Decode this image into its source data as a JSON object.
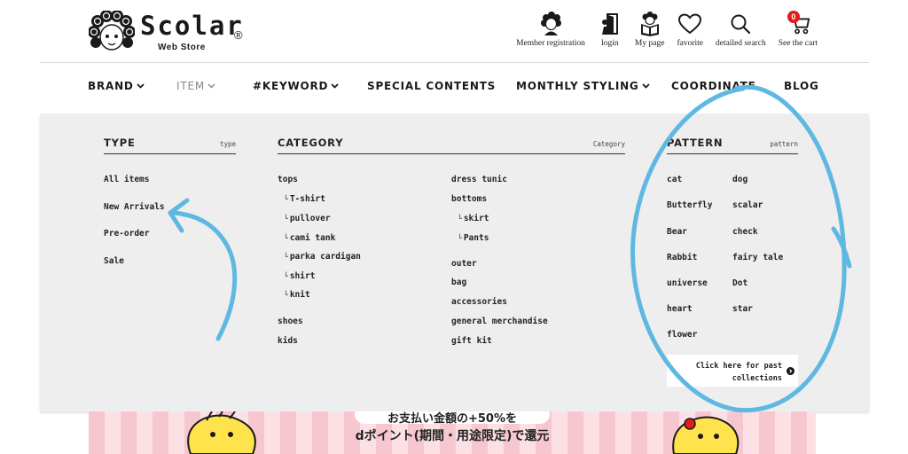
{
  "logo": {
    "wordmark": "Scolar",
    "sub": "Web Store",
    "reg": "®"
  },
  "header_nav": [
    {
      "label": "Member registration",
      "icon": "member-icon"
    },
    {
      "label": "login",
      "icon": "login-door-icon"
    },
    {
      "label": "My page",
      "icon": "mypage-icon"
    },
    {
      "label": "favorite",
      "icon": "heart-icon"
    },
    {
      "label": "detailed search",
      "icon": "search-icon"
    },
    {
      "label": "See the cart",
      "icon": "cart-icon",
      "badge": "0"
    }
  ],
  "main_nav": [
    {
      "label": "BRAND",
      "dropdown": true
    },
    {
      "label": "ITEM",
      "dropdown": true,
      "active": true
    },
    {
      "label": "#KEYWORD",
      "dropdown": true
    },
    {
      "label": "SPECIAL CONTENTS",
      "dropdown": false
    },
    {
      "label": "MONTHLY STYLING",
      "dropdown": true
    },
    {
      "label": "COORDINATE",
      "dropdown": false
    },
    {
      "label": "BLOG",
      "dropdown": false
    }
  ],
  "dropdown": {
    "type": {
      "title": "TYPE",
      "subtitle": "type",
      "items": [
        "All items",
        "New Arrivals",
        "Pre-order",
        "Sale"
      ]
    },
    "category": {
      "title": "CATEGORY",
      "subtitle": "Category",
      "col1": [
        {
          "label": "tops",
          "sub": false
        },
        {
          "label": "T-shirt",
          "sub": true
        },
        {
          "label": "pullover",
          "sub": true
        },
        {
          "label": "cami tank",
          "sub": true
        },
        {
          "label": "parka cardigan",
          "sub": true
        },
        {
          "label": "shirt",
          "sub": true
        },
        {
          "label": "knit",
          "sub": true
        },
        {
          "label": "shoes",
          "sub": false
        },
        {
          "label": "kids",
          "sub": false
        }
      ],
      "col2": [
        {
          "label": "dress tunic",
          "sub": false
        },
        {
          "label": "bottoms",
          "sub": false
        },
        {
          "label": "skirt",
          "sub": true
        },
        {
          "label": "Pants",
          "sub": true
        },
        {
          "label": "outer",
          "sub": false
        },
        {
          "label": "bag",
          "sub": false
        },
        {
          "label": "accessories",
          "sub": false
        },
        {
          "label": "general merchandise",
          "sub": false
        },
        {
          "label": "gift kit",
          "sub": false
        }
      ]
    },
    "pattern": {
      "title": "PATTERN",
      "subtitle": "pattern",
      "col1": [
        "cat",
        "Butterfly",
        "Bear",
        "Rabbit",
        "universe",
        "heart",
        "flower"
      ],
      "col2": [
        "dog",
        "scalar",
        "check",
        "fairy tale",
        "Dot",
        "star"
      ],
      "past_line1": "Click here for past",
      "past_line2": "collections"
    }
  },
  "banner": {
    "line1": "お支払い金額の+50%を",
    "line2": "dポイント(期間・用途限定)で還元"
  },
  "colors": {
    "annotation": "#5fb8e2",
    "cart_badge": "#e21b1b",
    "dropdown_bg": "#eeeeee",
    "banner_stripe": "#f7c7cf"
  }
}
